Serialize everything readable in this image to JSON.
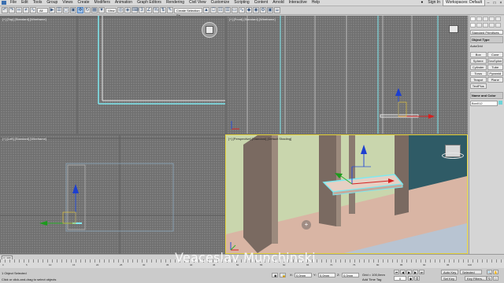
{
  "menu": {
    "items": [
      "File",
      "Edit",
      "Tools",
      "Group",
      "Views",
      "Create",
      "Modifiers",
      "Animation",
      "Graph Editors",
      "Rendering",
      "Civil View",
      "Customize",
      "Scripting",
      "Content",
      "Arnold",
      "Interactive",
      "Help"
    ],
    "sign_in": "Sign In",
    "workspace": "Workspaces: Default"
  },
  "toolbar": {
    "view_dropdown": "View",
    "selection_set": "Create Selection Se"
  },
  "viewports": {
    "top_label": "[+] [Top] [Standard] [Wireframe]",
    "front_label": "[+] [Front] [Standard] [Wireframe]",
    "left_label": "[+] [Left] [Standard] [Wireframe]",
    "perspective_label": "[+] [Perspective] [Standard] [Default Shading]"
  },
  "command_panel": {
    "dropdown": "Standard Primitives",
    "object_type_title": "Object Type",
    "autogrid": "AutoGrid",
    "buttons": [
      "Box",
      "Cone",
      "Sphere",
      "GeoSphere",
      "Cylinder",
      "Tube",
      "Torus",
      "Pyramid",
      "Teapot",
      "Plane",
      "TextPlus"
    ],
    "name_color_title": "Name and Color",
    "object_name": "Box012"
  },
  "timeline": {
    "frame": "0 / 100",
    "ticks": [
      "0",
      "5",
      "10",
      "15",
      "20",
      "25",
      "30",
      "35",
      "40",
      "45",
      "50",
      "55",
      "60",
      "65",
      "70",
      "75",
      "80",
      "85",
      "90",
      "95",
      "100"
    ]
  },
  "status": {
    "selection": "1 Object Selected",
    "prompt": "Click or click-and-drag to select objects",
    "x_label": "X:",
    "x_value": "0,0mm",
    "y_label": "Y:",
    "y_value": "0,0mm",
    "z_label": "Z:",
    "z_value": "0,0mm",
    "grid": "Grid = 100,0mm",
    "add_time_tag": "Add Time Tag",
    "auto_key": "Auto Key",
    "set_key": "Set Key",
    "selected": "Selected",
    "key_filters": "Key Filters...",
    "frame_field": "0"
  },
  "watermark": "Veaceslav Munchinski",
  "colors": {
    "viewport_grid": "#7d7d7d",
    "active_border": "#e5d33a",
    "selection_cyan": "#7fe9f0",
    "wall_green": "#c9d6ad",
    "panel_brown": "#7a6a61",
    "floor_pink": "#d9b5a4",
    "dark_teal": "#2f5b66"
  }
}
